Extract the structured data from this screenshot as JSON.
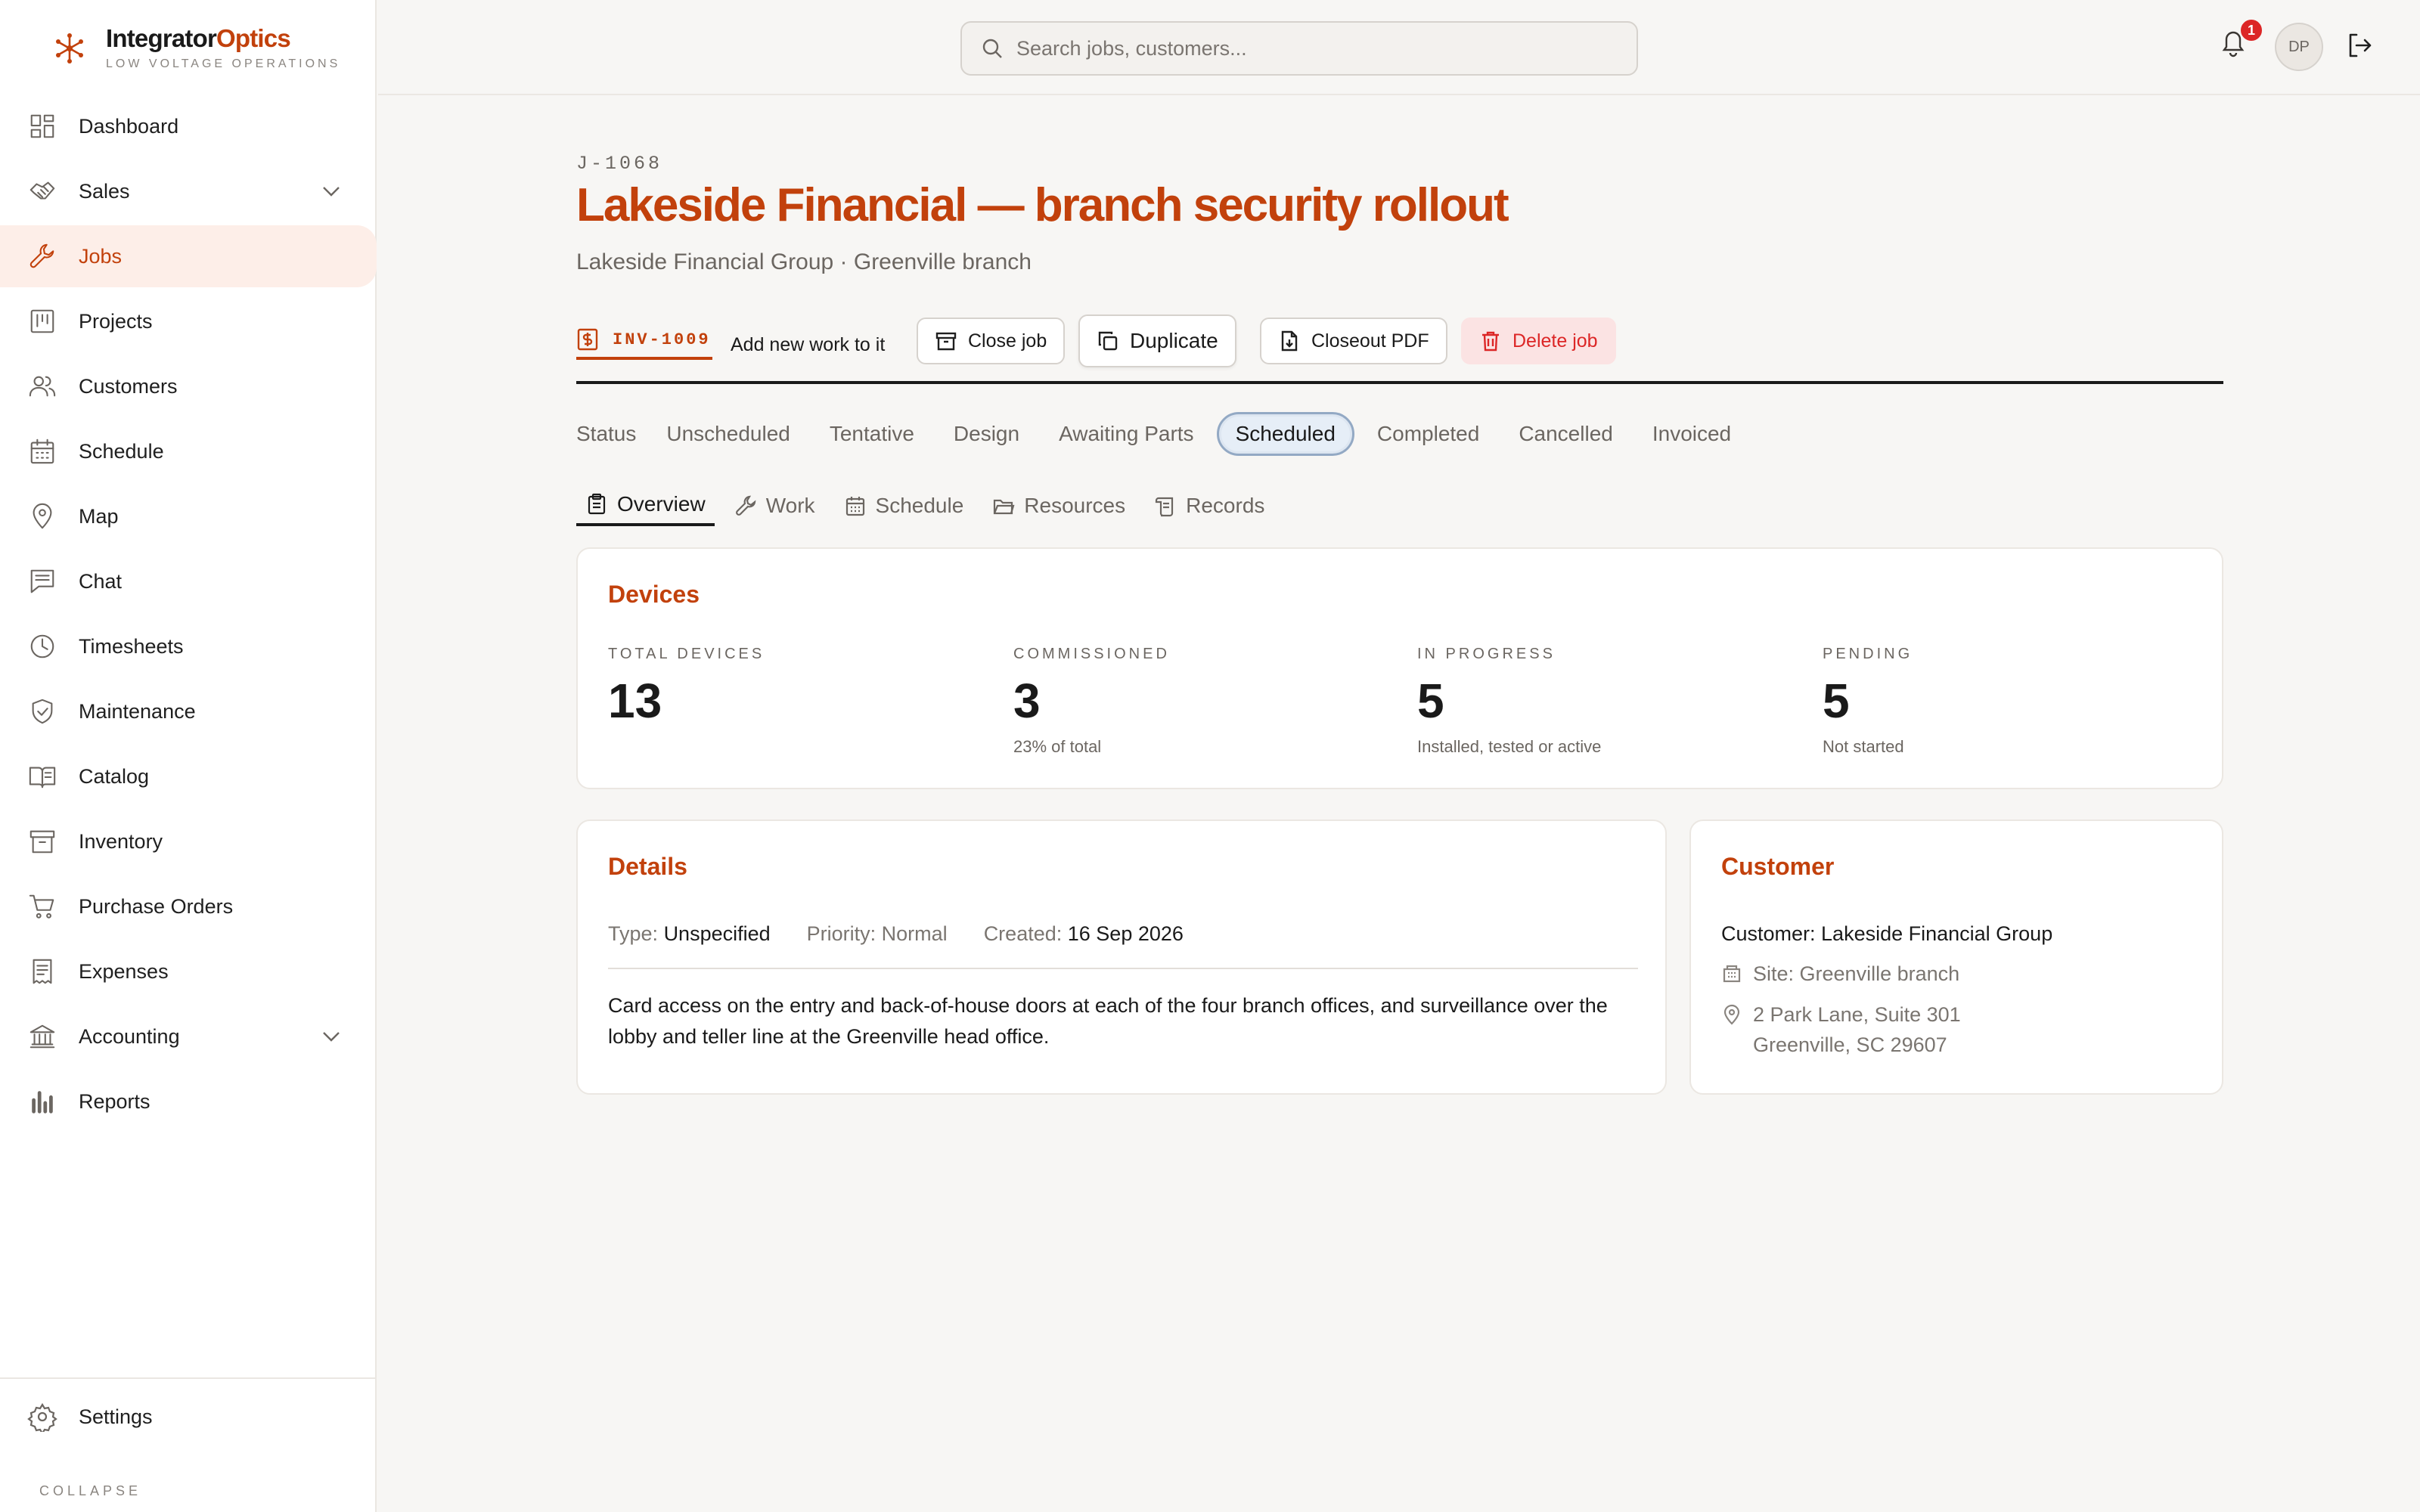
{
  "brand": {
    "name_part1": "Integrator",
    "name_part2": "Optics",
    "subtitle": "LOW VOLTAGE OPERATIONS"
  },
  "sidebar": {
    "items": [
      {
        "label": "Dashboard"
      },
      {
        "label": "Sales"
      },
      {
        "label": "Jobs"
      },
      {
        "label": "Projects"
      },
      {
        "label": "Customers"
      },
      {
        "label": "Schedule"
      },
      {
        "label": "Map"
      },
      {
        "label": "Chat"
      },
      {
        "label": "Timesheets"
      },
      {
        "label": "Maintenance"
      },
      {
        "label": "Catalog"
      },
      {
        "label": "Inventory"
      },
      {
        "label": "Purchase Orders"
      },
      {
        "label": "Expenses"
      },
      {
        "label": "Accounting"
      },
      {
        "label": "Reports"
      }
    ],
    "settings_label": "Settings",
    "collapse_label": "COLLAPSE"
  },
  "topbar": {
    "search_placeholder": "Search jobs, customers...",
    "notification_count": "1",
    "avatar_initials": "DP"
  },
  "job": {
    "id": "J-1068",
    "title": "Lakeside Financial — branch security rollout",
    "subtitle": "Lakeside Financial Group · Greenville branch"
  },
  "actions": {
    "invoice": "INV-1009",
    "add_work": "Add new work to it",
    "close_job": "Close job",
    "duplicate": "Duplicate",
    "closeout_pdf": "Closeout PDF",
    "delete_job": "Delete job"
  },
  "status": {
    "label": "Status",
    "options": [
      "Unscheduled",
      "Tentative",
      "Design",
      "Awaiting Parts",
      "Scheduled",
      "Completed",
      "Cancelled",
      "Invoiced"
    ],
    "selected": "Scheduled"
  },
  "tabs": [
    "Overview",
    "Work",
    "Schedule",
    "Resources",
    "Records"
  ],
  "devices": {
    "title": "Devices",
    "stats": [
      {
        "label": "TOTAL DEVICES",
        "value": "13",
        "note": ""
      },
      {
        "label": "COMMISSIONED",
        "value": "3",
        "note": "23% of total"
      },
      {
        "label": "IN PROGRESS",
        "value": "5",
        "note": "Installed, tested or active"
      },
      {
        "label": "PENDING",
        "value": "5",
        "note": "Not started"
      }
    ]
  },
  "details": {
    "title": "Details",
    "type_label": "Type:",
    "type_value": "Unspecified",
    "priority_label": "Priority:",
    "priority_value": "Normal",
    "created_label": "Created:",
    "created_value": "16 Sep 2026",
    "description": "Card access on the entry and back-of-house doors at each of the four branch offices, and surveillance over the lobby and teller line at the Greenville head office."
  },
  "customer": {
    "title": "Customer",
    "name": "Customer: Lakeside Financial Group",
    "site": "Site: Greenville branch",
    "address_line1": "2 Park Lane, Suite 301",
    "address_line2": "Greenville, SC 29607"
  },
  "colors": {
    "accent": "#c2410c",
    "danger": "#dc2626",
    "active_nav_bg": "#fdeee8"
  }
}
